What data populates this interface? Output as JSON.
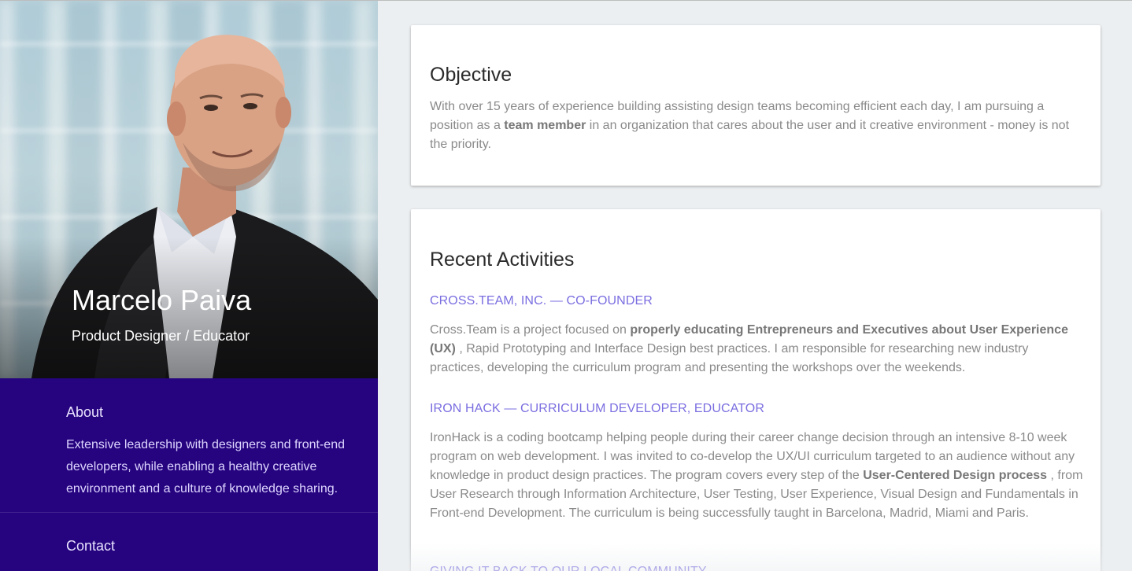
{
  "profile": {
    "name": "Marcelo Paiva",
    "role": "Product Designer / Educator",
    "photo_icon": "portrait-photo"
  },
  "sidebar": {
    "about_title": "About",
    "about_text": "Extensive leadership with designers and front-end developers, while enabling a healthy creative environment and a culture of knowledge sharing.",
    "contact_title": "Contact",
    "background_color": "#26037f"
  },
  "objective": {
    "title": "Objective",
    "text_before": "With over 15 years of experience building assisting design teams becoming efficient each day, I am pursuing a position as a ",
    "text_bold": "team member",
    "text_after": " in an organization that cares about the user and it creative environment - money is not the priority."
  },
  "activities": {
    "title": "Recent Activities",
    "items": [
      {
        "heading": "CROSS.TEAM, INC. — CO-FOUNDER",
        "text_before": "Cross.Team is a project focused on ",
        "text_bold": "properly educating Entrepreneurs and Executives about User Experience (UX)",
        "text_after": " , Rapid Prototyping and Interface Design best practices. I am responsible for researching new industry practices, developing the curriculum program and presenting the workshops over the weekends."
      },
      {
        "heading": "IRON HACK — CURRICULUM DEVELOPER, EDUCATOR",
        "text_before": "IronHack is a coding bootcamp helping people during their career change decision through an intensive 8-10 week program on web development. I was invited to co-develop the UX/UI curriculum targeted to an audience without any knowledge in product design practices. The program covers every step of the ",
        "text_bold": "User-Centered Design process",
        "text_after": " , from User Research through Information Architecture, User Testing, User Experience, Visual Design and Fundamentals in Front-end Development. The curriculum is being successfully taught in Barcelona, Madrid, Miami and Paris."
      },
      {
        "heading": "GIVING IT BACK TO OUR LOCAL COMMUNITY"
      }
    ]
  },
  "colors": {
    "accent": "#7a6ee0",
    "body_text": "#8a8a8a",
    "page_background": "#eceff1"
  }
}
